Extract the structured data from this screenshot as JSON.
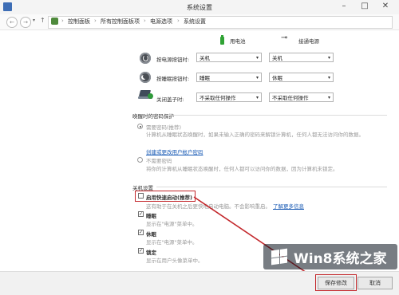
{
  "window": {
    "title": "系统设置"
  },
  "address": {
    "crumbs": [
      "控制面板",
      "所有控制面板项",
      "电源选项",
      "系统设置"
    ],
    "separator": "›"
  },
  "power": {
    "col_battery": "用电池",
    "col_plugged": "接通电源",
    "rows": [
      {
        "label": "按电源按钮时:",
        "battery": "关机",
        "plugged": "关机"
      },
      {
        "label": "按睡眠按钮时:",
        "battery": "睡眠",
        "plugged": "休眠"
      },
      {
        "label": "关闭盖子时:",
        "battery": "不采取任何操作",
        "plugged": "不采取任何操作"
      }
    ]
  },
  "password": {
    "section_title": "唤醒时的密码保护",
    "require_label": "需要密码(推荐)",
    "require_desc": "计算机从睡眠状态唤醒时，如果未输入正确的密码来解锁计算机，任何人都无法访问你的数据。",
    "require_link": "创建或更改用户帐户密码",
    "norequire_label": "不需要密码",
    "norequire_desc": "将你的计算机从睡眠状态唤醒时，任何人都可以访问你的数据，因为计算机未锁定。"
  },
  "shutdown": {
    "section_title": "关机设置",
    "fast_label": "启用快速启动(推荐)",
    "fast_desc": "这有助于在关机之后更快地启动电脑。不会影响重启。",
    "fast_link": "了解更多信息",
    "sleep_label": "睡眠",
    "sleep_desc": "显示在\"电源\"菜单中。",
    "hibernate_label": "休眠",
    "hibernate_desc": "显示在\"电源\"菜单中。",
    "lock_label": "锁定",
    "lock_desc": "显示在用户头像菜单中。"
  },
  "buttons": {
    "save": "保存修改",
    "cancel": "取消"
  },
  "watermark": {
    "text": "Win8系统之家"
  },
  "colors": {
    "highlight": "#c3272b",
    "link": "#1a5bb5",
    "battery": "#30a335"
  }
}
